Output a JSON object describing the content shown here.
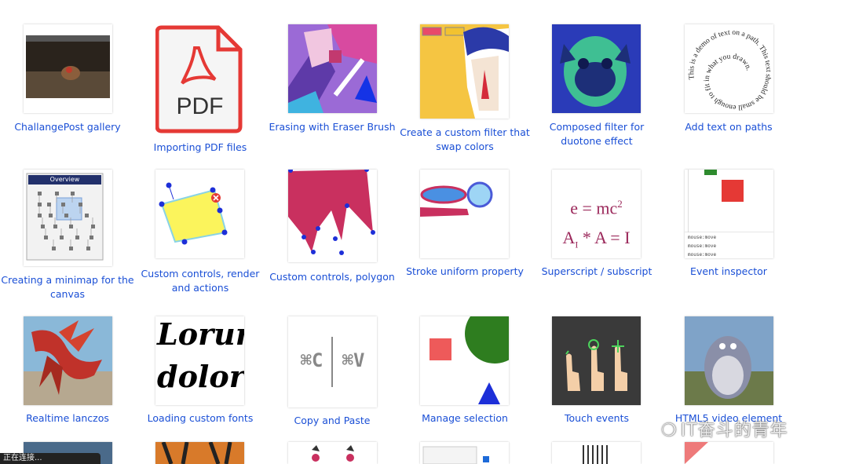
{
  "gallery": [
    {
      "caption": "ChallangePost gallery",
      "icon": "gallery-thumbnail"
    },
    {
      "caption": "Importing PDF files",
      "icon": "pdf-file-icon",
      "pdf_label": "PDF"
    },
    {
      "caption": "Erasing with Eraser Brush",
      "icon": "anime-eraser-thumbnail"
    },
    {
      "caption": "Create a custom filter that swap colors",
      "icon": "anime-filter-thumbnail"
    },
    {
      "caption": "Composed filter for duotone effect",
      "icon": "pug-duotone-thumbnail"
    },
    {
      "caption": "Add text on paths",
      "icon": "spiral-text-thumbnail",
      "path_text": "This is a demo of text on a path. This text should be small enough to fit in what you drawn."
    },
    {
      "caption": "Creating a minimap for the canvas",
      "icon": "minimap-thumbnail",
      "overview_label": "Overview"
    },
    {
      "caption": "Custom controls, render and actions",
      "icon": "custom-controls-thumbnail"
    },
    {
      "caption": "Custom controls, polygon",
      "icon": "polygon-thumbnail"
    },
    {
      "caption": "Stroke uniform property",
      "icon": "stroke-uniform-thumbnail"
    },
    {
      "caption": "Superscript / subscript",
      "icon": "superscript-thumbnail",
      "formula_1": "e = mc",
      "formula_1_sup": "2",
      "formula_2_a": "A",
      "formula_2_sub": "I",
      "formula_2_b": " * A = I"
    },
    {
      "caption": "Event inspector",
      "icon": "event-inspector-thumbnail",
      "log_line": "mouse:move"
    },
    {
      "caption": "Realtime lanczos",
      "icon": "dragon-thumbnail"
    },
    {
      "caption": "Loading custom fonts",
      "icon": "fonts-thumbnail",
      "font_line_1": "Lorum",
      "font_line_2": "dolor s"
    },
    {
      "caption": "Copy and Paste",
      "icon": "copy-paste-thumbnail",
      "copy_key": "⌘C",
      "paste_key": "⌘V"
    },
    {
      "caption": "Manage selection",
      "icon": "selection-thumbnail"
    },
    {
      "caption": "Touch events",
      "icon": "touch-thumbnail"
    },
    {
      "caption": "HTML5 video element",
      "icon": "video-thumbnail"
    }
  ],
  "watermark": "IT奋斗的青年",
  "status_text": "正在连接...",
  "colors": {
    "link": "#1a4fd6"
  }
}
